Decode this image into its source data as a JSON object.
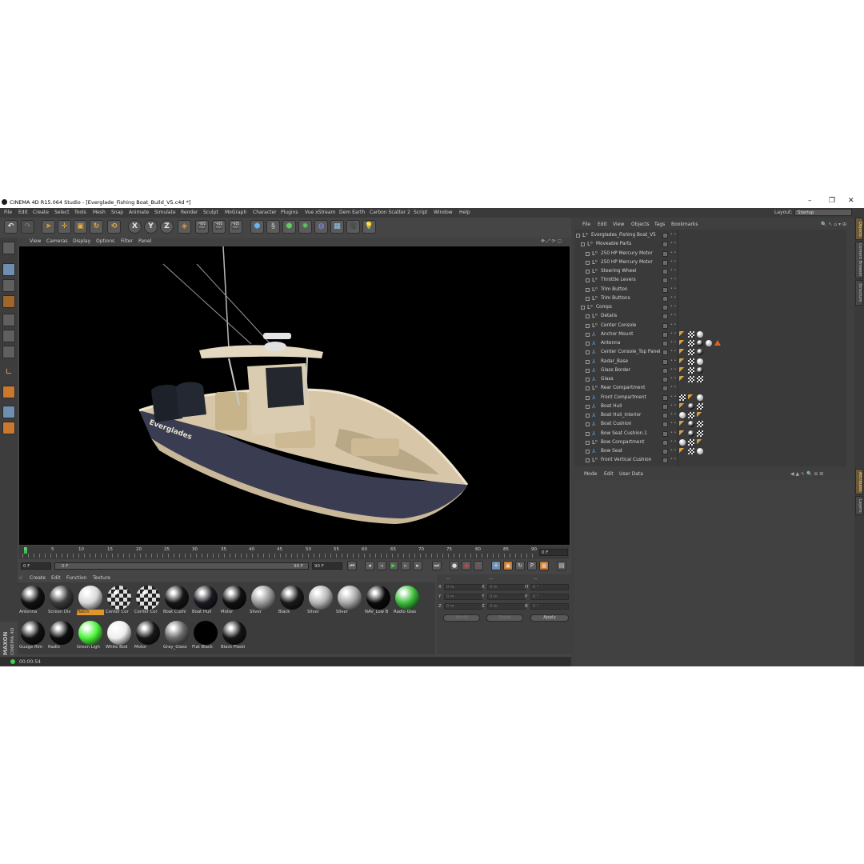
{
  "window": {
    "title": "CINEMA 4D R15.064 Studio - [Everglade_Fishing Boat_Build_V5.c4d *]",
    "minimize": "–",
    "maximize": "❐",
    "close": "✕"
  },
  "menubar": [
    "File",
    "Edit",
    "Create",
    "Select",
    "Tools",
    "Mesh",
    "Snap",
    "Animate",
    "Simulate",
    "Render",
    "Sculpt",
    "MoGraph",
    "Character",
    "Plugins",
    "Vue xStream",
    "Dem Earth",
    "Carbon Scatter 2",
    "Script",
    "Window",
    "Help"
  ],
  "layout": {
    "label": "Layout:",
    "value": "Startup"
  },
  "toolbar": {
    "icons": [
      "undo-icon",
      "redo-icon",
      "select-live-icon",
      "move-icon",
      "scale-icon",
      "rotate-icon",
      "recent-icon",
      "x-axis-icon",
      "y-axis-icon",
      "z-axis-icon",
      "coordinate-system-icon",
      "render-view-icon",
      "render-picture-viewer-icon",
      "edit-render-settings-icon",
      "cube-icon",
      "spline-pen-icon",
      "nurbs-icon",
      "array-icon",
      "deformer-icon",
      "floor-icon",
      "camera-icon",
      "light-icon"
    ],
    "axis_labels": [
      "X",
      "Y",
      "Z"
    ]
  },
  "viewport_menu": [
    "View",
    "Cameras",
    "Display",
    "Options",
    "Filter",
    "Panel"
  ],
  "timeline": {
    "ticks": [
      "0",
      "5",
      "10",
      "15",
      "20",
      "25",
      "30",
      "35",
      "40",
      "45",
      "50",
      "55",
      "60",
      "65",
      "70",
      "75",
      "80",
      "85",
      "90"
    ],
    "current_frame": "0 F",
    "start_frame": "0 F",
    "range_start": "0 F",
    "range_end": "90 F",
    "end_frame": "90 F"
  },
  "material_menu": [
    "Create",
    "Edit",
    "Function",
    "Texture"
  ],
  "materials": [
    {
      "name": "Antenna",
      "color": "#111111",
      "style": "dark"
    },
    {
      "name": "Screen Dis",
      "color": "#3a3a3a",
      "style": "dark"
    },
    {
      "name": "Hatch",
      "color": "#d8d8d8",
      "style": "light",
      "selected": true
    },
    {
      "name": "Center Cor",
      "color": "#222222",
      "style": "checker"
    },
    {
      "name": "Center Cor",
      "color": "#222222",
      "style": "checker"
    },
    {
      "name": "Boat Cushi",
      "color": "#151515",
      "style": "dark"
    },
    {
      "name": "Boat Hull",
      "color": "#1a1a22",
      "style": "dark"
    },
    {
      "name": "Motor",
      "color": "#101010",
      "style": "dark"
    },
    {
      "name": "Silver",
      "color": "#9a9a9a",
      "style": "metal"
    },
    {
      "name": "Black",
      "color": "#1a1a1a",
      "style": "dark"
    },
    {
      "name": "Silver",
      "color": "#b5b5b5",
      "style": "metal"
    },
    {
      "name": "Silver",
      "color": "#a8a8a8",
      "style": "metal"
    },
    {
      "name": "NAV_Low B",
      "color": "#0a0a0a",
      "style": "dark"
    },
    {
      "name": "Radio Glas",
      "color": "#3bbd3b",
      "style": "green"
    },
    {
      "name": "Guage Rim",
      "color": "#111111",
      "style": "dark"
    },
    {
      "name": "Radio",
      "color": "#0d0d0d",
      "style": "dark"
    },
    {
      "name": "Green Ligh",
      "color": "#4cf23a",
      "style": "bright"
    },
    {
      "name": "White Bod",
      "color": "#eeeeee",
      "style": "white"
    },
    {
      "name": "Motor",
      "color": "#161616",
      "style": "dark"
    },
    {
      "name": "Gray_Glass",
      "color": "#6a6a6a",
      "style": "metal"
    },
    {
      "name": "Flat Black",
      "color": "#000000",
      "style": "flat"
    },
    {
      "name": "Black Plasti",
      "color": "#141414",
      "style": "dark"
    }
  ],
  "coordinates": {
    "header_left": "--",
    "header_mid": "--",
    "header_right": "--",
    "rows": [
      {
        "a": "X",
        "av": "0 m",
        "b": "X",
        "bv": "0 m",
        "c": "H",
        "cv": "0 °"
      },
      {
        "a": "Y",
        "av": "0 m",
        "b": "Y",
        "bv": "0 m",
        "c": "P",
        "cv": "0 °"
      },
      {
        "a": "Z",
        "av": "0 m",
        "b": "Z",
        "bv": "0 m",
        "c": "B",
        "cv": "0 °"
      }
    ],
    "world": "World",
    "scale": "Scale",
    "apply": "Apply"
  },
  "status": {
    "time": "00:00:54"
  },
  "maxon": {
    "brand": "MAXON",
    "product": "CINEMA 4D"
  },
  "object_menu": [
    "File",
    "Edit",
    "View",
    "Objects",
    "Tags",
    "Bookmarks"
  ],
  "objects": [
    {
      "name": "Everglades_Fishing Boat_V5",
      "indent": 0,
      "type": "null",
      "tags": []
    },
    {
      "name": "Moveable Parts",
      "indent": 1,
      "type": "null",
      "tags": []
    },
    {
      "name": "250 HP Mercury Motor",
      "indent": 2,
      "type": "null",
      "tags": []
    },
    {
      "name": "250 HP Mercury Motor",
      "indent": 2,
      "type": "null",
      "tags": []
    },
    {
      "name": "Steering Wheel",
      "indent": 2,
      "type": "null",
      "tags": []
    },
    {
      "name": "Throttle Levers",
      "indent": 2,
      "type": "null",
      "tags": []
    },
    {
      "name": "Trim Button",
      "indent": 2,
      "type": "null",
      "tags": []
    },
    {
      "name": "Trim Buttons",
      "indent": 2,
      "type": "null",
      "tags": []
    },
    {
      "name": "Comps",
      "indent": 1,
      "type": "null",
      "tags": []
    },
    {
      "name": "Details",
      "indent": 2,
      "type": "null",
      "tags": []
    },
    {
      "name": "Center Console",
      "indent": 2,
      "type": "null",
      "tags": []
    },
    {
      "name": "Anchor Mount",
      "indent": 2,
      "type": "poly",
      "tags": [
        "phong",
        "checker",
        "grey"
      ]
    },
    {
      "name": "Antenna",
      "indent": 2,
      "type": "poly",
      "tags": [
        "phong",
        "checker",
        "dark",
        "grey",
        "warn"
      ]
    },
    {
      "name": "Center Console_Top Panel",
      "indent": 2,
      "type": "poly",
      "tags": [
        "phong",
        "checker",
        "dark"
      ]
    },
    {
      "name": "Radar_Base",
      "indent": 2,
      "type": "poly",
      "tags": [
        "phong",
        "checker",
        "grey"
      ]
    },
    {
      "name": "Glass Border",
      "indent": 2,
      "type": "poly",
      "tags": [
        "phong",
        "checker",
        "dark"
      ]
    },
    {
      "name": "Glass",
      "indent": 2,
      "type": "poly",
      "tags": [
        "phong",
        "checker",
        "checker"
      ]
    },
    {
      "name": "Rear Compartment",
      "indent": 2,
      "type": "null",
      "tags": []
    },
    {
      "name": "Front Compartment",
      "indent": 2,
      "type": "poly",
      "tags": [
        "checker",
        "phong",
        "grey"
      ]
    },
    {
      "name": "Boat Hull",
      "indent": 2,
      "type": "poly",
      "tags": [
        "phong",
        "dark",
        "checker"
      ]
    },
    {
      "name": "Boat Hull_interior",
      "indent": 2,
      "type": "poly",
      "tags": [
        "grey",
        "checker",
        "phong"
      ]
    },
    {
      "name": "Boat Cushion",
      "indent": 2,
      "type": "poly",
      "tags": [
        "phong",
        "dark",
        "checker"
      ]
    },
    {
      "name": "Bow Seat Cushion.1",
      "indent": 2,
      "type": "poly",
      "tags": [
        "phong",
        "dark",
        "checker"
      ]
    },
    {
      "name": "Bow Compartment",
      "indent": 2,
      "type": "null",
      "tags": [
        "grey",
        "checker",
        "phong"
      ]
    },
    {
      "name": "Bow Seat",
      "indent": 2,
      "type": "poly",
      "tags": [
        "phong",
        "checker",
        "grey"
      ]
    },
    {
      "name": "Front Vertical Cushion",
      "indent": 2,
      "type": "null",
      "tags": []
    }
  ],
  "attribute_menu": [
    "Mode",
    "Edit",
    "User Data"
  ],
  "side_tabs": [
    "Objects",
    "Content Browser",
    "Structure"
  ],
  "side_tabs_lower": [
    "Attributes",
    "Layers"
  ],
  "boat": {
    "brand_text": "Everglades"
  }
}
